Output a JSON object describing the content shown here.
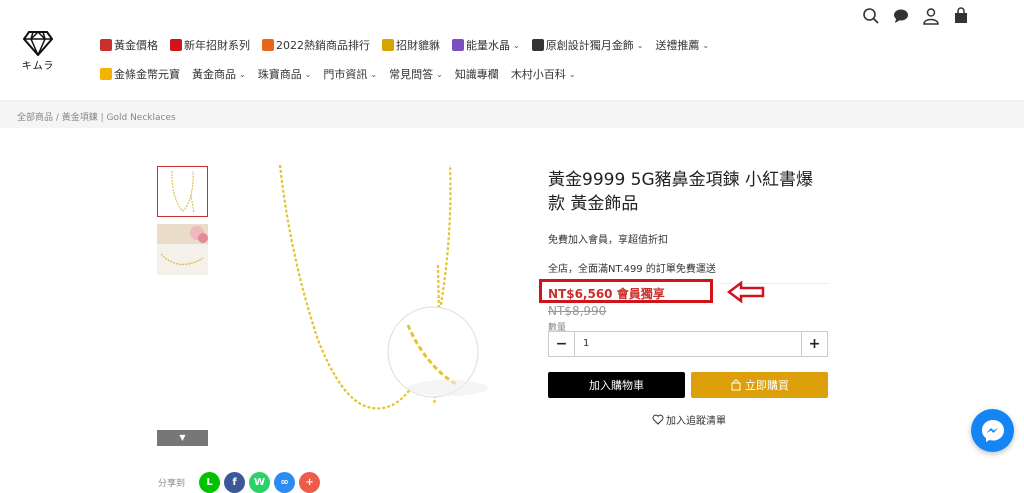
{
  "logo": {
    "text": "キムラ",
    "icon": "diamond-icon"
  },
  "nav": {
    "row1": [
      {
        "label": "黃金價格",
        "icon": "chart-icon",
        "color": "#c9302c",
        "has_dropdown": false
      },
      {
        "label": "新年招財系列",
        "icon": "red-envelope-icon",
        "color": "#d1141b",
        "has_dropdown": false
      },
      {
        "label": "2022熱銷商品排行",
        "icon": "fire-icon",
        "color": "#e8651a",
        "has_dropdown": false
      },
      {
        "label": "招財貔貅",
        "icon": "gold-medal-icon",
        "color": "#d9a400",
        "has_dropdown": false
      },
      {
        "label": "能量水晶",
        "icon": "crystal-icon",
        "color": "#7b4fc4",
        "has_dropdown": true
      },
      {
        "label": "原創設計獨月金飾",
        "icon": "bottle-icon",
        "color": "#333333",
        "has_dropdown": true
      },
      {
        "label": "送禮推薦",
        "icon": "",
        "color": "",
        "has_dropdown": true
      }
    ],
    "row2": [
      {
        "label": "金條金幣元寶",
        "icon": "star-icon",
        "color": "#f3b200",
        "has_dropdown": false
      },
      {
        "label": "黃金商品",
        "icon": "",
        "color": "",
        "has_dropdown": true
      },
      {
        "label": "珠寶商品",
        "icon": "",
        "color": "",
        "has_dropdown": true
      },
      {
        "label": "門市資訊",
        "icon": "",
        "color": "",
        "has_dropdown": true
      },
      {
        "label": "常見問答",
        "icon": "",
        "color": "",
        "has_dropdown": true
      },
      {
        "label": "知識專欄",
        "icon": "",
        "color": "",
        "has_dropdown": false
      },
      {
        "label": "木村小百科",
        "icon": "",
        "color": "",
        "has_dropdown": true
      }
    ]
  },
  "top_icons": [
    "search-icon",
    "chat-icon",
    "user-icon",
    "bag-icon"
  ],
  "breadcrumb": "全部商品 / 黃金項鍊 | Gold Necklaces",
  "product": {
    "title": "黃金9999 5G豬鼻金項鍊 小紅書爆款 黃金飾品",
    "promo_member": "免費加入會員，享超值折扣",
    "promo_shipping": "全店，全面滿NT.499 的訂單免費運送",
    "member_price": "NT$6,560 會員獨享",
    "original_price": "NT$8,990",
    "quantity_label": "數量",
    "quantity": "1",
    "add_to_cart": "加入購物車",
    "buy_now": "立即購買",
    "wishlist": "加入追蹤清單"
  },
  "share": {
    "label": "分享到",
    "buttons": [
      {
        "name": "line-share-button",
        "glyph": "L",
        "color": "#00c300"
      },
      {
        "name": "facebook-share-button",
        "glyph": "f",
        "color": "#3b5998"
      },
      {
        "name": "whatsapp-share-button",
        "glyph": "W",
        "color": "#25d366"
      },
      {
        "name": "copy-link-button",
        "glyph": "∞",
        "color": "#2d8cf0"
      },
      {
        "name": "more-share-button",
        "glyph": "+",
        "color": "#f05a48"
      }
    ]
  },
  "colors": {
    "accent_red": "#c9302c",
    "buy_gold": "#dda00b",
    "messenger_blue": "#1584f5",
    "highlight_box": "#d1141b"
  }
}
